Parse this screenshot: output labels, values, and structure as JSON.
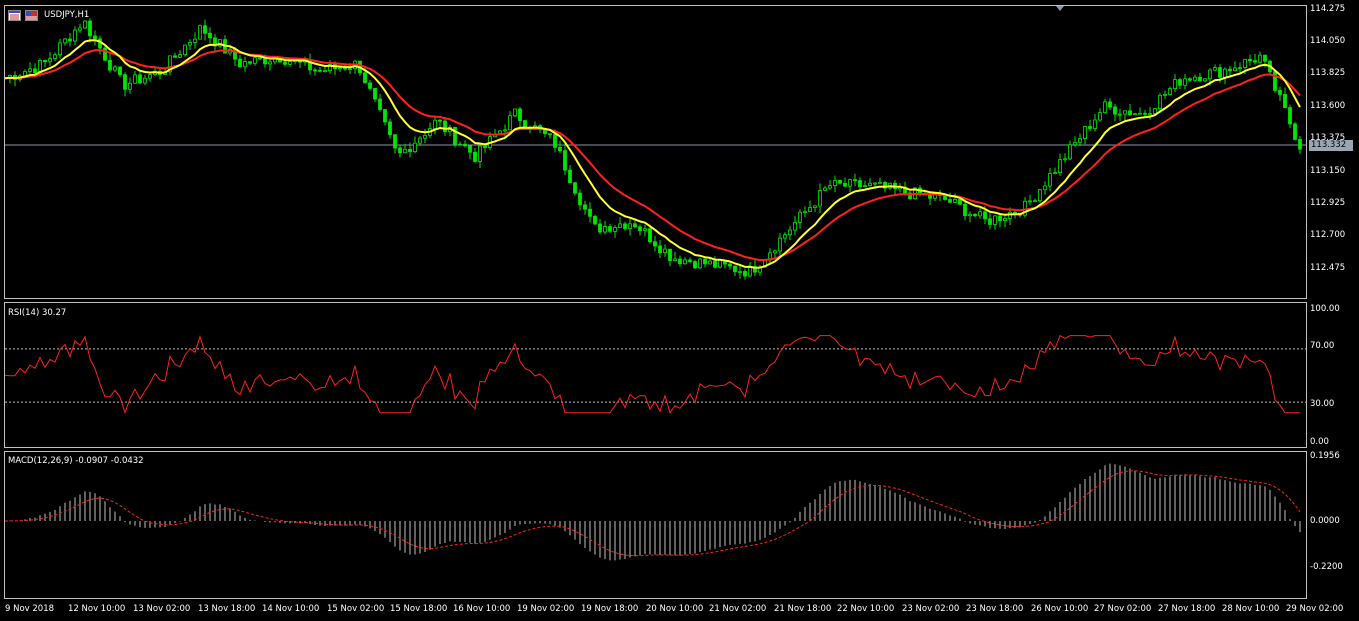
{
  "chart_window": {
    "symbol_title": "USDJPY,H1",
    "icons": [
      "chart-list-icon",
      "flag-icon"
    ]
  },
  "main_pane": {
    "price_axis": [
      "114.275",
      "114.050",
      "113.825",
      "113.600",
      "113.375",
      "113.150",
      "112.925",
      "112.700",
      "112.475"
    ],
    "current_price": "113.332",
    "colors": {
      "bull_candle": "#00e600",
      "ma_fast": "#ffff33",
      "ma_slow": "#ff2020",
      "bid_line": "#8a97a6"
    }
  },
  "rsi_pane": {
    "title": "RSI(14) 30.27",
    "axis": [
      "100.00",
      "70.00",
      "30.00",
      "0.00"
    ],
    "color": "#ff2020"
  },
  "macd_pane": {
    "title": "MACD(12,26,9) -0.0907 -0.0432",
    "axis": [
      "0.1956",
      "0.0000",
      "-0.2200"
    ],
    "colors": {
      "histogram": "#c0c0c0",
      "signal": "#ff2020"
    }
  },
  "time_axis": [
    "9 Nov 2018",
    "12 Nov 10:00",
    "13 Nov 02:00",
    "13 Nov 18:00",
    "14 Nov 10:00",
    "15 Nov 02:00",
    "15 Nov 18:00",
    "16 Nov 10:00",
    "19 Nov 02:00",
    "19 Nov 18:00",
    "20 Nov 10:00",
    "21 Nov 02:00",
    "21 Nov 18:00",
    "22 Nov 10:00",
    "23 Nov 02:00",
    "23 Nov 18:00",
    "26 Nov 10:00",
    "27 Nov 02:00",
    "27 Nov 18:00",
    "28 Nov 10:00",
    "29 Nov 02:00"
  ],
  "chart_data": {
    "type": "line",
    "series": [
      {
        "name": "",
        "values": [
          113.8,
          113.9,
          114.2,
          113.75,
          113.85,
          114.15,
          113.9,
          113.95,
          113.85,
          113.9,
          113.25,
          113.5,
          113.25,
          113.55,
          113.35,
          112.75,
          112.8,
          112.55,
          112.5,
          112.45,
          112.75,
          113.05,
          113.05,
          113.0,
          112.95,
          112.8,
          112.9,
          113.25,
          113.6,
          113.55,
          113.8,
          113.85,
          113.95,
          113.33
        ]
      }
    ]
  }
}
